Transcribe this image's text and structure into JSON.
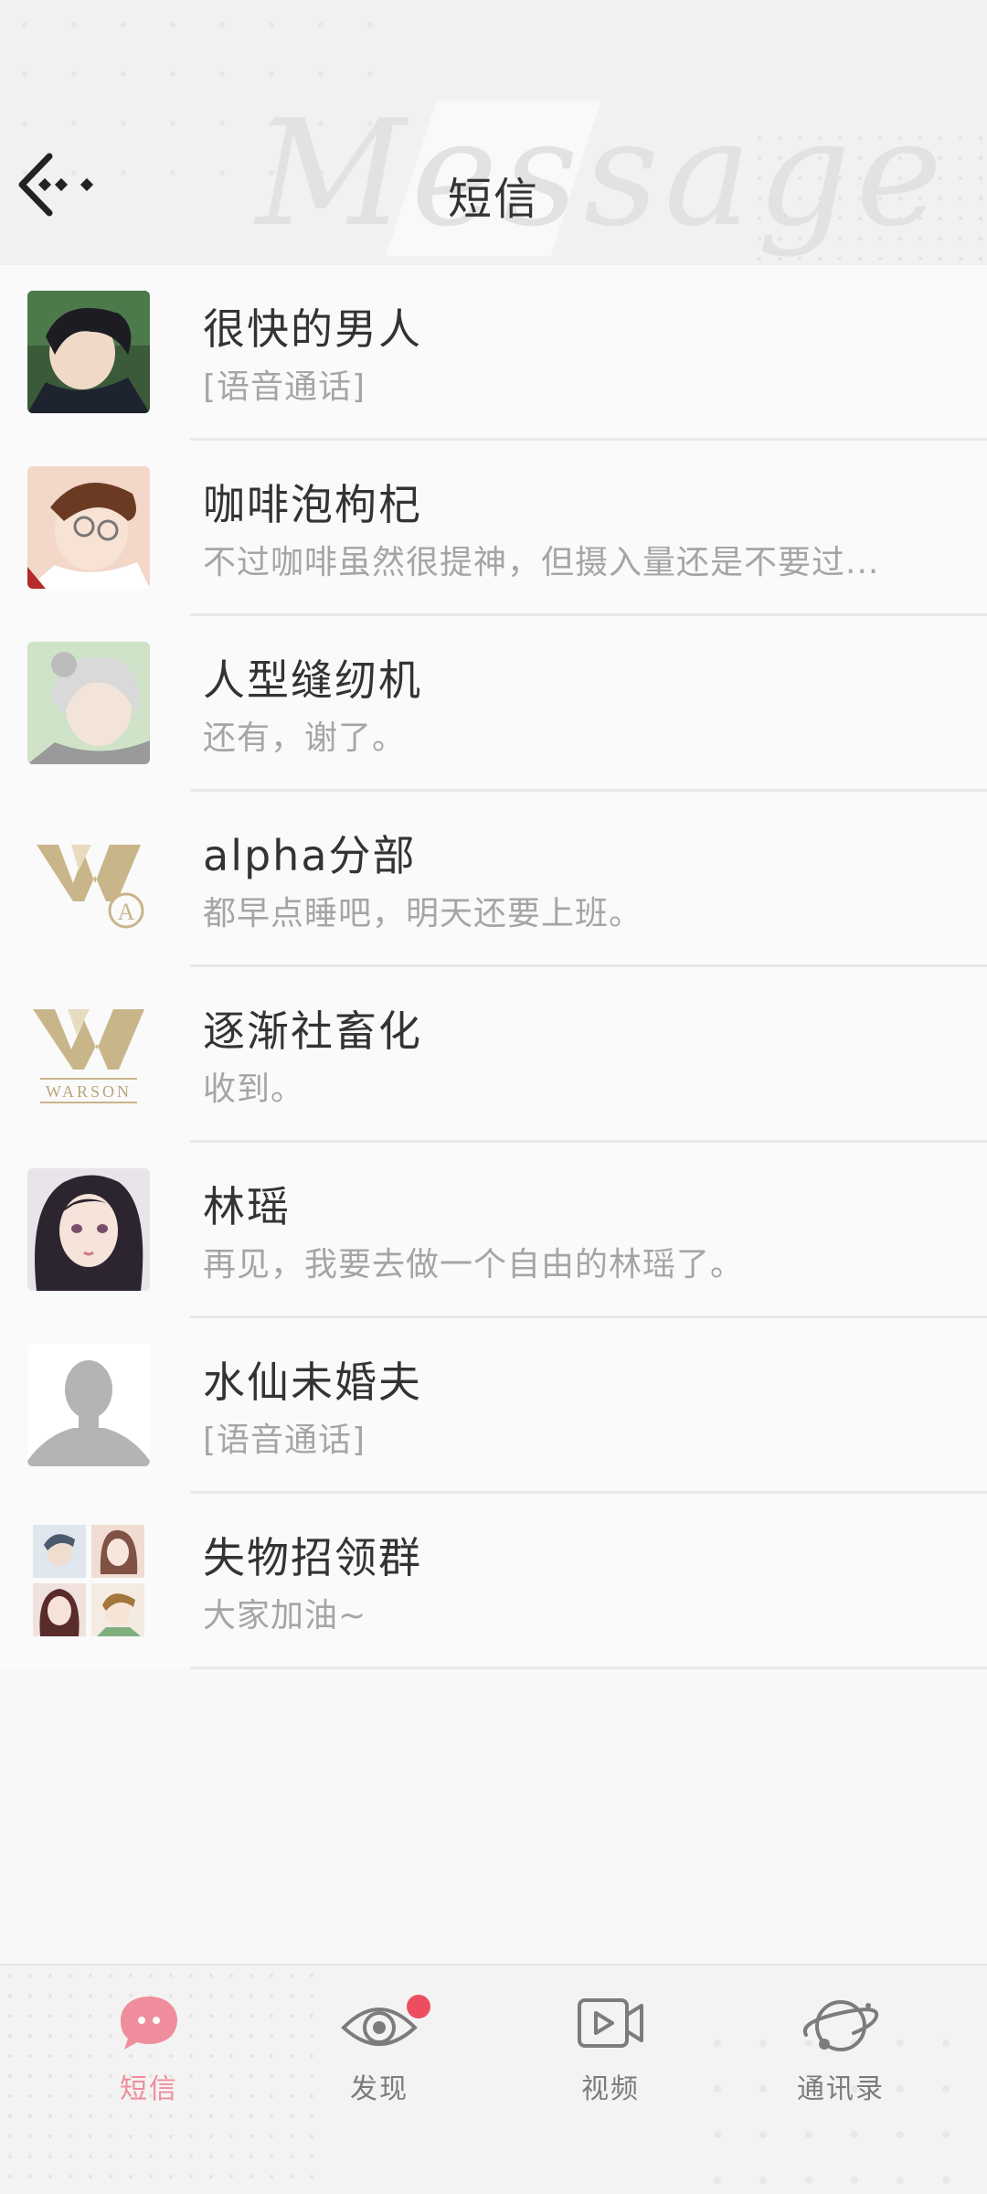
{
  "header": {
    "title": "短信",
    "watermark": "Message"
  },
  "conversations": [
    {
      "name": "很快的男人",
      "preview": "[语音通话]",
      "avatar": "portrait-dark-hair"
    },
    {
      "name": "咖啡泡枸杞",
      "preview": "不过咖啡虽然很提神，但摄入量还是不要过...",
      "avatar": "portrait-glasses"
    },
    {
      "name": "人型缝纫机",
      "preview": "还有，谢了。",
      "avatar": "portrait-silver-hair"
    },
    {
      "name": "alpha分部",
      "preview": "都早点睡吧，明天还要上班。",
      "avatar": "logo-w-a"
    },
    {
      "name": "逐渐社畜化",
      "preview": "收到。",
      "avatar": "logo-warson"
    },
    {
      "name": "林瑶",
      "preview": "再见，我要去做一个自由的林瑶了。",
      "avatar": "portrait-woman"
    },
    {
      "name": "水仙未婚夫",
      "preview": "[语音通话]",
      "avatar": "default-silhouette"
    },
    {
      "name": "失物招领群",
      "preview": "大家加油~",
      "avatar": "group-collage"
    }
  ],
  "logo": {
    "brand_text": "WARSON",
    "sub_letter": "A",
    "gold": "#c9b58a"
  },
  "bottom_nav": [
    {
      "label": "短信",
      "icon": "chat-bubble-icon",
      "active": true
    },
    {
      "label": "发现",
      "icon": "eye-icon",
      "active": false,
      "badge": true
    },
    {
      "label": "视频",
      "icon": "video-icon",
      "active": false
    },
    {
      "label": "通讯录",
      "icon": "planet-icon",
      "active": false
    }
  ],
  "colors": {
    "accent": "#ef8d9c",
    "badge": "#ee4d60",
    "text": "#333333",
    "muted": "#a5a5a5"
  }
}
